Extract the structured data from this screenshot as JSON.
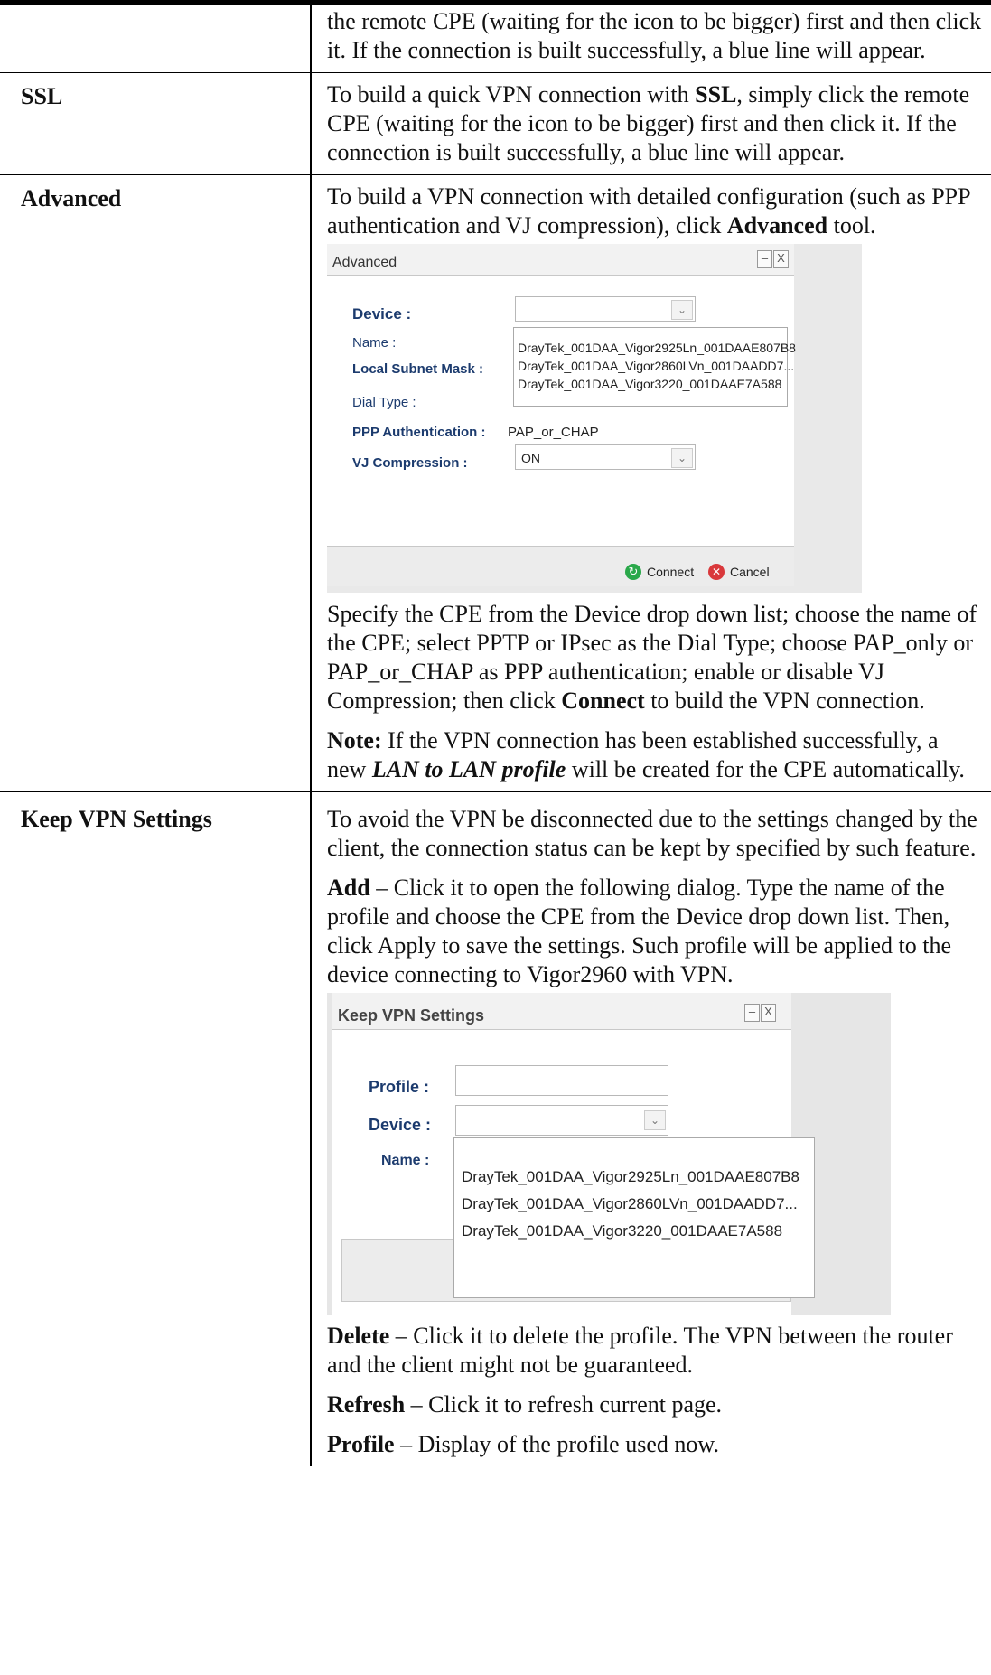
{
  "rows": {
    "intro": {
      "text": "the remote CPE (waiting for the icon to be bigger) first and then click it. If the connection is built successfully, a blue line will appear."
    },
    "ssl": {
      "label": "SSL",
      "t1": "To build a quick VPN connection with ",
      "t1b": "SSL",
      "t2": ", simply click the remote CPE (waiting for the icon to be bigger) first and then click it. If the connection is built successfully, a blue line will appear."
    },
    "advanced": {
      "label": "Advanced",
      "t1": "To build a VPN connection with detailed configuration (such as PPP authentication and VJ compression), click ",
      "t1b": "Advanced",
      "t2": " tool.",
      "p2a": "Specify the CPE from the Device drop down list; choose the name of the CPE; select PPTP or IPsec as the Dial Type; choose PAP_only or PAP_or_CHAP as PPP authentication; enable or disable VJ Compression; then click ",
      "p2b": "Connect",
      "p2c": " to build the VPN connection.",
      "note_label": "Note:",
      "note_a": " If the VPN connection has been established successfully, a new ",
      "note_b": "LAN to LAN profile",
      "note_c": " will be created for the CPE automatically."
    },
    "keep": {
      "label": "Keep VPN Settings",
      "p1": "To avoid the VPN be disconnected due to the settings changed by the client, the connection status can be kept by specified by such feature.",
      "add_b": "Add",
      "add_t": " – Click it to open the following dialog. Type the name of the profile and choose the CPE from the Device drop down list. Then, click Apply to save the settings. Such profile will be applied to the device connecting to Vigor2960 with VPN.",
      "del_b": "Delete",
      "del_t": " – Click it to delete the profile. The VPN between the router and the client might not be guaranteed.",
      "ref_b": "Refresh",
      "ref_t": " – Click it to refresh current page.",
      "prof_b": "Profile",
      "prof_t": " – Display of the profile used now."
    }
  },
  "adv_dialog": {
    "title": "Advanced",
    "device_label": "Device :",
    "name_label": "Name :",
    "subnet_label": "Local Subnet Mask :",
    "dial_label": "Dial Type :",
    "ppp_label": "PPP Authentication :",
    "ppp_value": "PAP_or_CHAP",
    "vj_label": "VJ Compression :",
    "vj_value": "ON",
    "options": [
      "DrayTek_001DAA_Vigor2925Ln_001DAAE807B8",
      "DrayTek_001DAA_Vigor2860LVn_001DAADD7...",
      "DrayTek_001DAA_Vigor3220_001DAAE7A588"
    ],
    "connect": "Connect",
    "cancel": "Cancel",
    "min": "–",
    "close": "X"
  },
  "keep_dialog": {
    "title": "Keep VPN Settings",
    "profile_label": "Profile :",
    "device_label": "Device :",
    "name_label": "Name :",
    "options": [
      "DrayTek_001DAA_Vigor2925Ln_001DAAE807B8",
      "DrayTek_001DAA_Vigor2860LVn_001DAADD7...",
      "DrayTek_001DAA_Vigor3220_001DAAE7A588"
    ],
    "min": "–",
    "close": "X"
  }
}
